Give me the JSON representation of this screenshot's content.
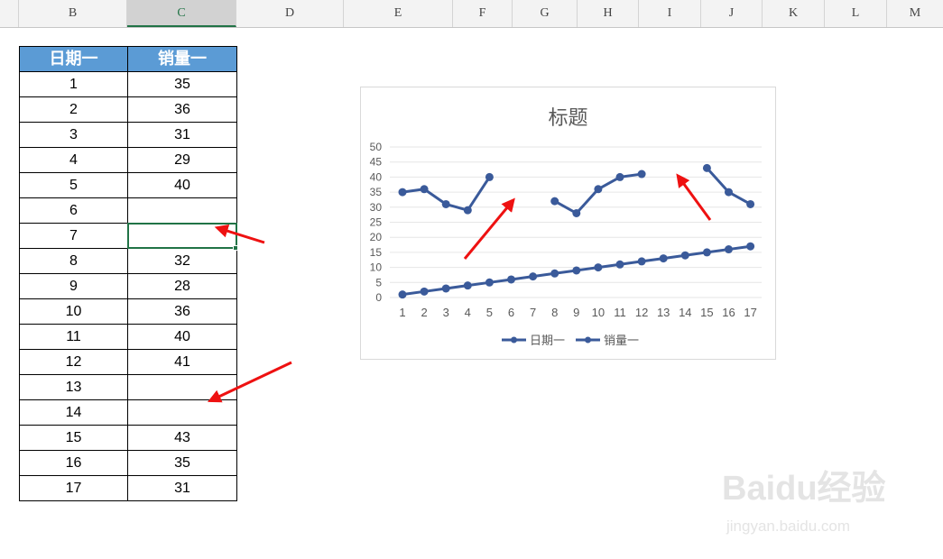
{
  "column_headers": [
    "B",
    "C",
    "D",
    "E",
    "F",
    "G",
    "H",
    "I",
    "J",
    "K",
    "L",
    "M"
  ],
  "selected_column": "C",
  "table": {
    "headers": [
      "日期一",
      "销量一"
    ],
    "rows": [
      [
        "1",
        "35"
      ],
      [
        "2",
        "36"
      ],
      [
        "3",
        "31"
      ],
      [
        "4",
        "29"
      ],
      [
        "5",
        "40"
      ],
      [
        "6",
        ""
      ],
      [
        "7",
        ""
      ],
      [
        "8",
        "32"
      ],
      [
        "9",
        "28"
      ],
      [
        "10",
        "36"
      ],
      [
        "11",
        "40"
      ],
      [
        "12",
        "41"
      ],
      [
        "13",
        ""
      ],
      [
        "14",
        ""
      ],
      [
        "15",
        "43"
      ],
      [
        "16",
        "35"
      ],
      [
        "17",
        "31"
      ]
    ]
  },
  "colors": {
    "header_fill": "#5b9bd5",
    "series": "#3a5a9a",
    "arrow": "#ee1111",
    "selection": "#217346"
  },
  "chart_data": {
    "type": "line",
    "title": "标题",
    "x": [
      1,
      2,
      3,
      4,
      5,
      6,
      7,
      8,
      9,
      10,
      11,
      12,
      13,
      14,
      15,
      16,
      17
    ],
    "ylim": [
      0,
      50
    ],
    "yticks": [
      0,
      5,
      10,
      15,
      20,
      25,
      30,
      35,
      40,
      45,
      50
    ],
    "grid": true,
    "legend": "bottom",
    "series": [
      {
        "name": "日期一",
        "values": [
          1,
          2,
          3,
          4,
          5,
          6,
          7,
          8,
          9,
          10,
          11,
          12,
          13,
          14,
          15,
          16,
          17
        ]
      },
      {
        "name": "销量一",
        "values": [
          35,
          36,
          31,
          29,
          40,
          null,
          null,
          32,
          28,
          36,
          40,
          41,
          null,
          null,
          43,
          35,
          31
        ]
      }
    ]
  },
  "watermark": {
    "brand": "Baidu经验",
    "url": "jingyan.baidu.com"
  }
}
